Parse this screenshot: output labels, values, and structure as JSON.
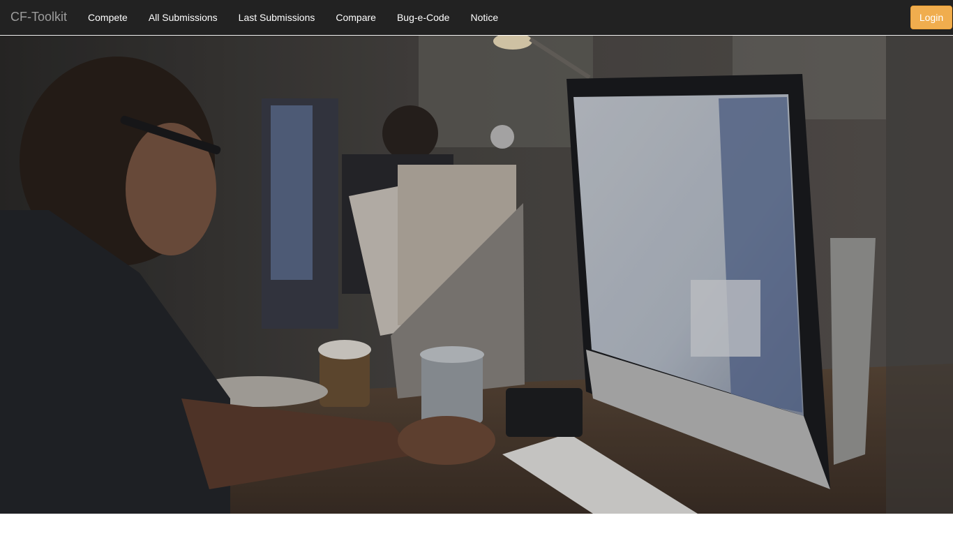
{
  "brand": "CF-Toolkit",
  "nav": {
    "items": [
      {
        "label": "Compete"
      },
      {
        "label": "All Submissions"
      },
      {
        "label": "Last Submissions"
      },
      {
        "label": "Compare"
      },
      {
        "label": "Bug-e-Code"
      },
      {
        "label": "Notice"
      }
    ]
  },
  "login_label": "Login",
  "colors": {
    "navbar": "#222222",
    "brand_text": "#9d9d9d",
    "login_button": "#f0ad4e"
  }
}
